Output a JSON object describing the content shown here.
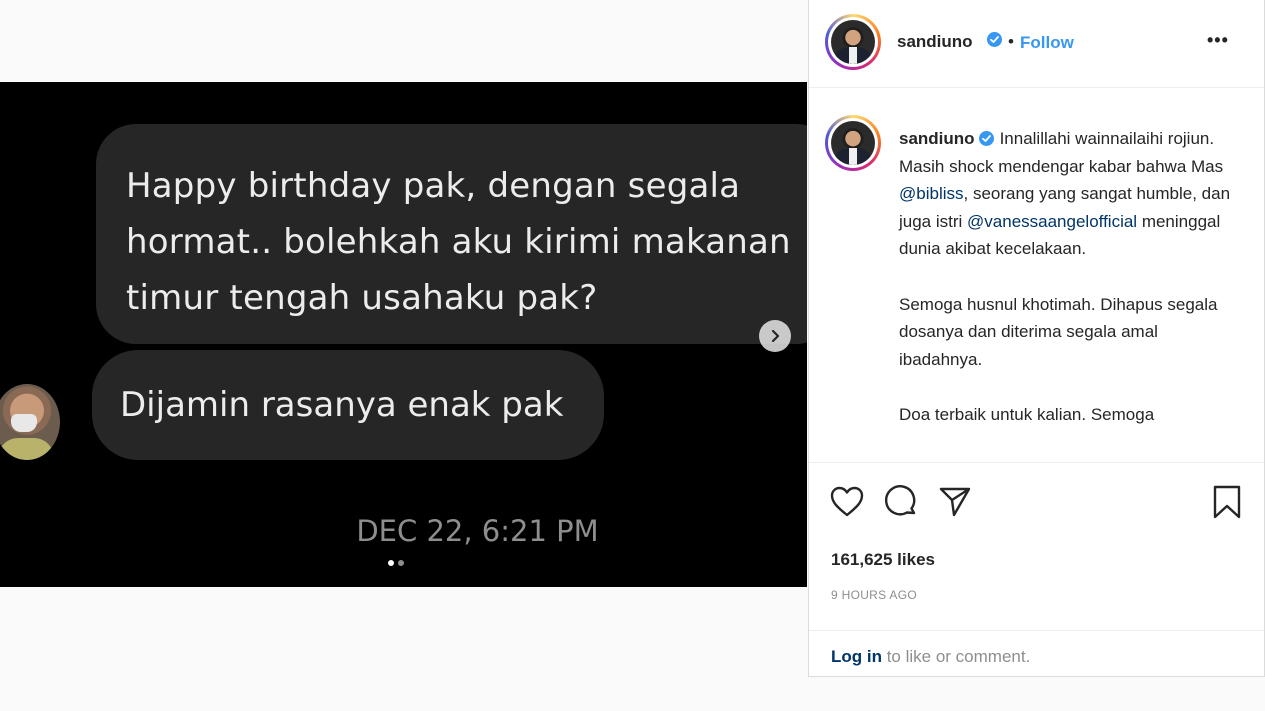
{
  "media": {
    "message_1": "Happy birthday pak, dengan segala hormat.. bolehkah aku kirimi makanan timur tengah usahaku pak?",
    "message_2": "Dijamin rasanya enak pak",
    "timestamp": "DEC 22, 6:21 PM",
    "carousel": {
      "total": 2,
      "active": 1
    }
  },
  "header": {
    "username": "sandiuno",
    "separator": "•",
    "follow_label": "Follow",
    "more_label": "•••"
  },
  "caption": {
    "username": "sandiuno",
    "p1_a": "Innalillahi wainnailaihi rojiun. Masih shock mendengar kabar bahwa Mas ",
    "mention_1": "@bibliss",
    "p1_b": ", seorang yang sangat humble, dan juga istri ",
    "mention_2": "@vanessaangelofficial",
    "p1_c": " meninggal dunia akibat kecelakaan.",
    "p2": "Semoga husnul khotimah. Dihapus segala dosanya dan diterima segala amal ibadahnya.",
    "p3": "Doa terbaik untuk kalian. Semoga"
  },
  "actions": {
    "like_icon": "heart-icon",
    "comment_icon": "comment-icon",
    "share_icon": "share-icon",
    "save_icon": "bookmark-icon"
  },
  "stats": {
    "likes": "161,625 likes",
    "time_ago": "9 HOURS AGO"
  },
  "footer": {
    "login_link": "Log in",
    "login_text": " to like or comment."
  },
  "colors": {
    "link_blue": "#3897f0",
    "mention": "#003569",
    "bubble": "#262626",
    "muted": "#8e8e8e"
  }
}
